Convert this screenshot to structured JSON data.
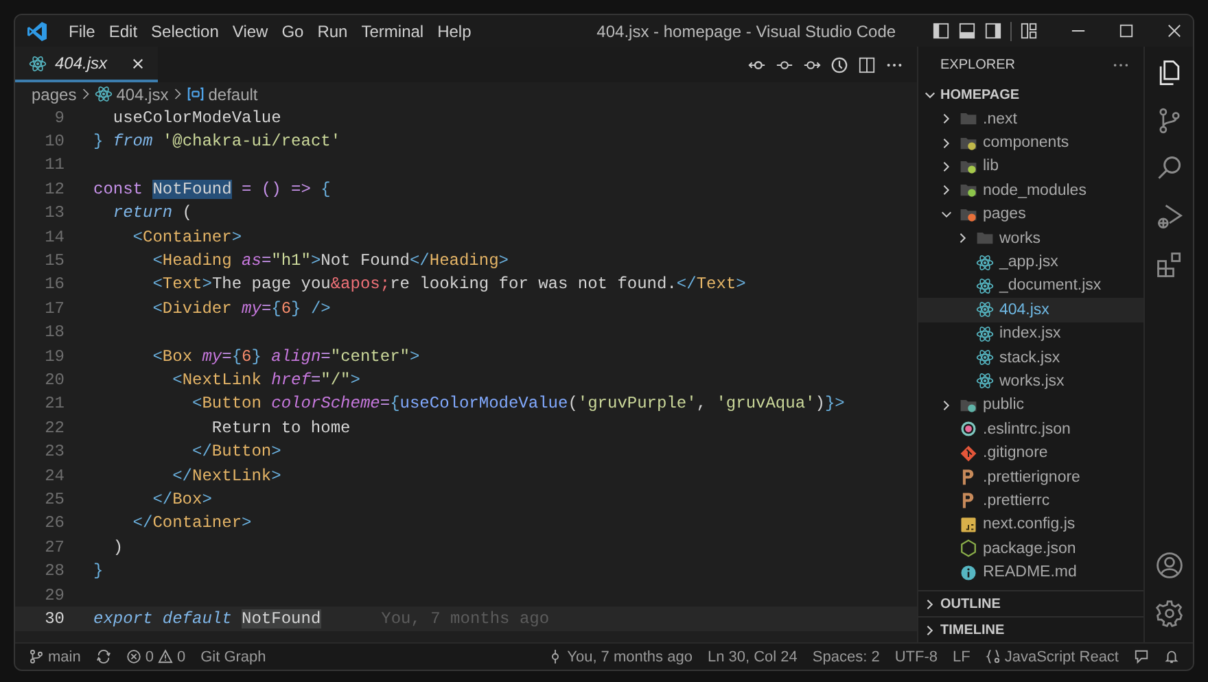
{
  "window": {
    "title": "404.jsx - homepage - Visual Studio Code"
  },
  "menu": [
    "File",
    "Edit",
    "Selection",
    "View",
    "Go",
    "Run",
    "Terminal",
    "Help"
  ],
  "tabs": [
    {
      "label": "404.jsx",
      "selected": true,
      "preview": true
    }
  ],
  "breadcrumb": [
    "pages",
    "404.jsx",
    "default"
  ],
  "code_lines": [
    {
      "n": "9",
      "tokens": [
        {
          "t": "  useColorModeValue",
          "kind": "plain"
        }
      ]
    },
    {
      "n": "10",
      "tokens": [
        {
          "t": "} ",
          "kind": "bracket"
        },
        {
          "t": "from ",
          "kind": "keyword2"
        },
        {
          "t": "'@chakra-ui/react'",
          "kind": "string"
        }
      ]
    },
    {
      "n": "11"
    },
    {
      "n": "12",
      "tokens": [
        {
          "t": "const ",
          "kind": "keyword"
        },
        {
          "t": "NotFound",
          "kind": "plain",
          "highlighted": true
        },
        {
          "t": " = () => ",
          "kind": "operator"
        },
        {
          "t": "{",
          "kind": "bracket"
        }
      ]
    },
    {
      "n": "13",
      "tokens": [
        {
          "t": "  return",
          "kind": "keyword2"
        },
        {
          "t": " (",
          "kind": "plain"
        }
      ]
    },
    {
      "n": "14",
      "tokens": [
        {
          "t": "    <",
          "kind": "bracket"
        },
        {
          "t": "Container",
          "kind": "tag"
        },
        {
          "t": ">",
          "kind": "bracket"
        }
      ]
    },
    {
      "n": "15",
      "tokens": [
        {
          "t": "      <",
          "kind": "bracket"
        },
        {
          "t": "Heading ",
          "kind": "tag"
        },
        {
          "t": "as",
          "kind": "attribute"
        },
        {
          "t": "=",
          "kind": "operator"
        },
        {
          "t": "\"h1\"",
          "kind": "string"
        },
        {
          "t": ">",
          "kind": "bracket"
        },
        {
          "t": "Not Found",
          "kind": "plain"
        },
        {
          "t": "</",
          "kind": "bracket"
        },
        {
          "t": "Heading",
          "kind": "tag"
        },
        {
          "t": ">",
          "kind": "bracket"
        }
      ]
    },
    {
      "n": "16",
      "tokens": [
        {
          "t": "      <",
          "kind": "bracket"
        },
        {
          "t": "Text",
          "kind": "tag"
        },
        {
          "t": ">",
          "kind": "bracket"
        },
        {
          "t": "The page you",
          "kind": "plain"
        },
        {
          "t": "&apos;",
          "kind": "entity"
        },
        {
          "t": "re looking for was not found.",
          "kind": "plain"
        },
        {
          "t": "</",
          "kind": "bracket"
        },
        {
          "t": "Text",
          "kind": "tag"
        },
        {
          "t": ">",
          "kind": "bracket"
        }
      ]
    },
    {
      "n": "17",
      "tokens": [
        {
          "t": "      <",
          "kind": "bracket"
        },
        {
          "t": "Divider ",
          "kind": "tag"
        },
        {
          "t": "my",
          "kind": "attribute"
        },
        {
          "t": "=",
          "kind": "operator"
        },
        {
          "t": "{",
          "kind": "bracket"
        },
        {
          "t": "6",
          "kind": "number"
        },
        {
          "t": "} />",
          "kind": "bracket"
        }
      ]
    },
    {
      "n": "18"
    },
    {
      "n": "19",
      "tokens": [
        {
          "t": "      <",
          "kind": "bracket"
        },
        {
          "t": "Box ",
          "kind": "tag"
        },
        {
          "t": "my",
          "kind": "attribute"
        },
        {
          "t": "=",
          "kind": "operator"
        },
        {
          "t": "{",
          "kind": "bracket"
        },
        {
          "t": "6",
          "kind": "number"
        },
        {
          "t": "} ",
          "kind": "bracket"
        },
        {
          "t": "align",
          "kind": "attribute"
        },
        {
          "t": "=",
          "kind": "operator"
        },
        {
          "t": "\"center\"",
          "kind": "string"
        },
        {
          "t": ">",
          "kind": "bracket"
        }
      ]
    },
    {
      "n": "20",
      "tokens": [
        {
          "t": "        <",
          "kind": "bracket"
        },
        {
          "t": "NextLink ",
          "kind": "tag"
        },
        {
          "t": "href",
          "kind": "attribute"
        },
        {
          "t": "=",
          "kind": "operator"
        },
        {
          "t": "\"/\"",
          "kind": "string"
        },
        {
          "t": ">",
          "kind": "bracket"
        }
      ]
    },
    {
      "n": "21",
      "tokens": [
        {
          "t": "          <",
          "kind": "bracket"
        },
        {
          "t": "Button ",
          "kind": "tag"
        },
        {
          "t": "colorScheme",
          "kind": "attribute"
        },
        {
          "t": "=",
          "kind": "operator"
        },
        {
          "t": "{",
          "kind": "bracket"
        },
        {
          "t": "useColorModeValue",
          "kind": "function"
        },
        {
          "t": "(",
          "kind": "plain"
        },
        {
          "t": "'gruvPurple'",
          "kind": "string"
        },
        {
          "t": ", ",
          "kind": "plain"
        },
        {
          "t": "'gruvAqua'",
          "kind": "string"
        },
        {
          "t": ")",
          "kind": "plain"
        },
        {
          "t": "}>",
          "kind": "bracket"
        }
      ]
    },
    {
      "n": "22",
      "tokens": [
        {
          "t": "            Return to home",
          "kind": "plain"
        }
      ]
    },
    {
      "n": "23",
      "tokens": [
        {
          "t": "          </",
          "kind": "bracket"
        },
        {
          "t": "Button",
          "kind": "tag"
        },
        {
          "t": ">",
          "kind": "bracket"
        }
      ]
    },
    {
      "n": "24",
      "tokens": [
        {
          "t": "        </",
          "kind": "bracket"
        },
        {
          "t": "NextLink",
          "kind": "tag"
        },
        {
          "t": ">",
          "kind": "bracket"
        }
      ]
    },
    {
      "n": "25",
      "tokens": [
        {
          "t": "      </",
          "kind": "bracket"
        },
        {
          "t": "Box",
          "kind": "tag"
        },
        {
          "t": ">",
          "kind": "bracket"
        }
      ]
    },
    {
      "n": "26",
      "tokens": [
        {
          "t": "    </",
          "kind": "bracket"
        },
        {
          "t": "Container",
          "kind": "tag"
        },
        {
          "t": ">",
          "kind": "bracket"
        }
      ]
    },
    {
      "n": "27",
      "tokens": [
        {
          "t": "  )",
          "kind": "plain"
        }
      ]
    },
    {
      "n": "28",
      "tokens": [
        {
          "t": "}",
          "kind": "bracket"
        }
      ]
    },
    {
      "n": "29"
    },
    {
      "n": "30",
      "current": true,
      "tokens": [
        {
          "t": "export default ",
          "kind": "keyword2"
        },
        {
          "t": "NotFound",
          "kind": "plain",
          "highlighted": true
        }
      ],
      "blame": "You, 7 months ago"
    }
  ],
  "explorer": {
    "title": "EXPLORER",
    "root": "HOMEPAGE",
    "items": [
      {
        "name": ".next",
        "kind": "folder",
        "expanded": false,
        "selected": false
      },
      {
        "name": "components",
        "kind": "folder",
        "color": "#c0b84a",
        "expanded": false,
        "selected": false
      },
      {
        "name": "lib",
        "kind": "folder",
        "color": "#a6c94b",
        "expanded": false,
        "selected": false
      },
      {
        "name": "node_modules",
        "kind": "folder",
        "color": "#8bc34a",
        "expanded": false,
        "selected": false
      },
      {
        "name": "pages",
        "kind": "folder",
        "color": "#e8703a",
        "expanded": true,
        "selected": false,
        "children": [
          {
            "name": "works",
            "kind": "folder",
            "expanded": false,
            "selected": false
          },
          {
            "name": "_app.jsx",
            "kind": "react",
            "selected": false
          },
          {
            "name": "_document.jsx",
            "kind": "react",
            "selected": false
          },
          {
            "name": "404.jsx",
            "kind": "react",
            "selected": true
          },
          {
            "name": "index.jsx",
            "kind": "react",
            "selected": false
          },
          {
            "name": "stack.jsx",
            "kind": "react",
            "selected": false
          },
          {
            "name": "works.jsx",
            "kind": "react",
            "selected": false
          }
        ]
      },
      {
        "name": "public",
        "kind": "folder",
        "color": "#5fb3a8",
        "expanded": false,
        "selected": false
      },
      {
        "name": ".eslintrc.json",
        "kind": "lint",
        "selected": false
      },
      {
        "name": ".gitignore",
        "kind": "git",
        "selected": false
      },
      {
        "name": ".prettierignore",
        "kind": "prettier",
        "selected": false
      },
      {
        "name": ".prettierrc",
        "kind": "prettier",
        "selected": false
      },
      {
        "name": "next.config.js",
        "kind": "js",
        "selected": false
      },
      {
        "name": "package.json",
        "kind": "node",
        "selected": false
      },
      {
        "name": "README.md",
        "kind": "info",
        "selected": false
      }
    ],
    "sections": [
      "OUTLINE",
      "TIMELINE"
    ]
  },
  "status_bar": {
    "branch": "main",
    "errors": "0",
    "warnings": "0",
    "git_graph": "Git Graph",
    "blame": "You, 7 months ago",
    "position": "Ln 30, Col 24",
    "spaces": "Spaces: 2",
    "encoding": "UTF-8",
    "eol": "LF",
    "language": "JavaScript React"
  }
}
